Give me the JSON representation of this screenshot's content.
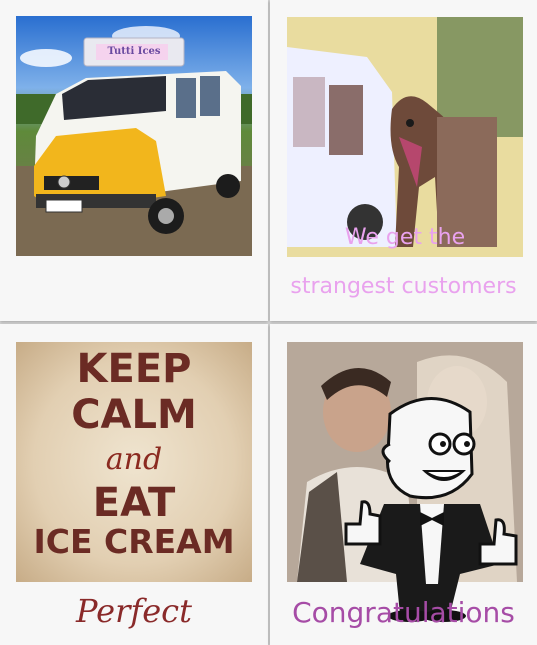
{
  "cards": [
    {
      "photo_alt": "Ice cream van",
      "van_sign": "Tutti Ices",
      "caption": ""
    },
    {
      "photo_alt": "Camel at ice cream van",
      "overlay_line1": "We get the",
      "overlay_line2": "strangest customers"
    },
    {
      "poster_line1": "KEEP",
      "poster_line2": "CALM",
      "poster_line3": "and",
      "poster_line4": "EAT",
      "poster_line5": "ICE CREAM",
      "caption": "Perfect"
    },
    {
      "photo_alt": "Wedding couple",
      "caption": "Congratulations"
    }
  ],
  "colors": {
    "caption_purple": "#a64ca6",
    "caption_brown": "#8a2a2a",
    "overlay_pink": "#e9a2ee",
    "poster_brown": "#6b2b24"
  },
  "mascot": {
    "icon": "thumbs-up-cartoon-man-icon"
  }
}
